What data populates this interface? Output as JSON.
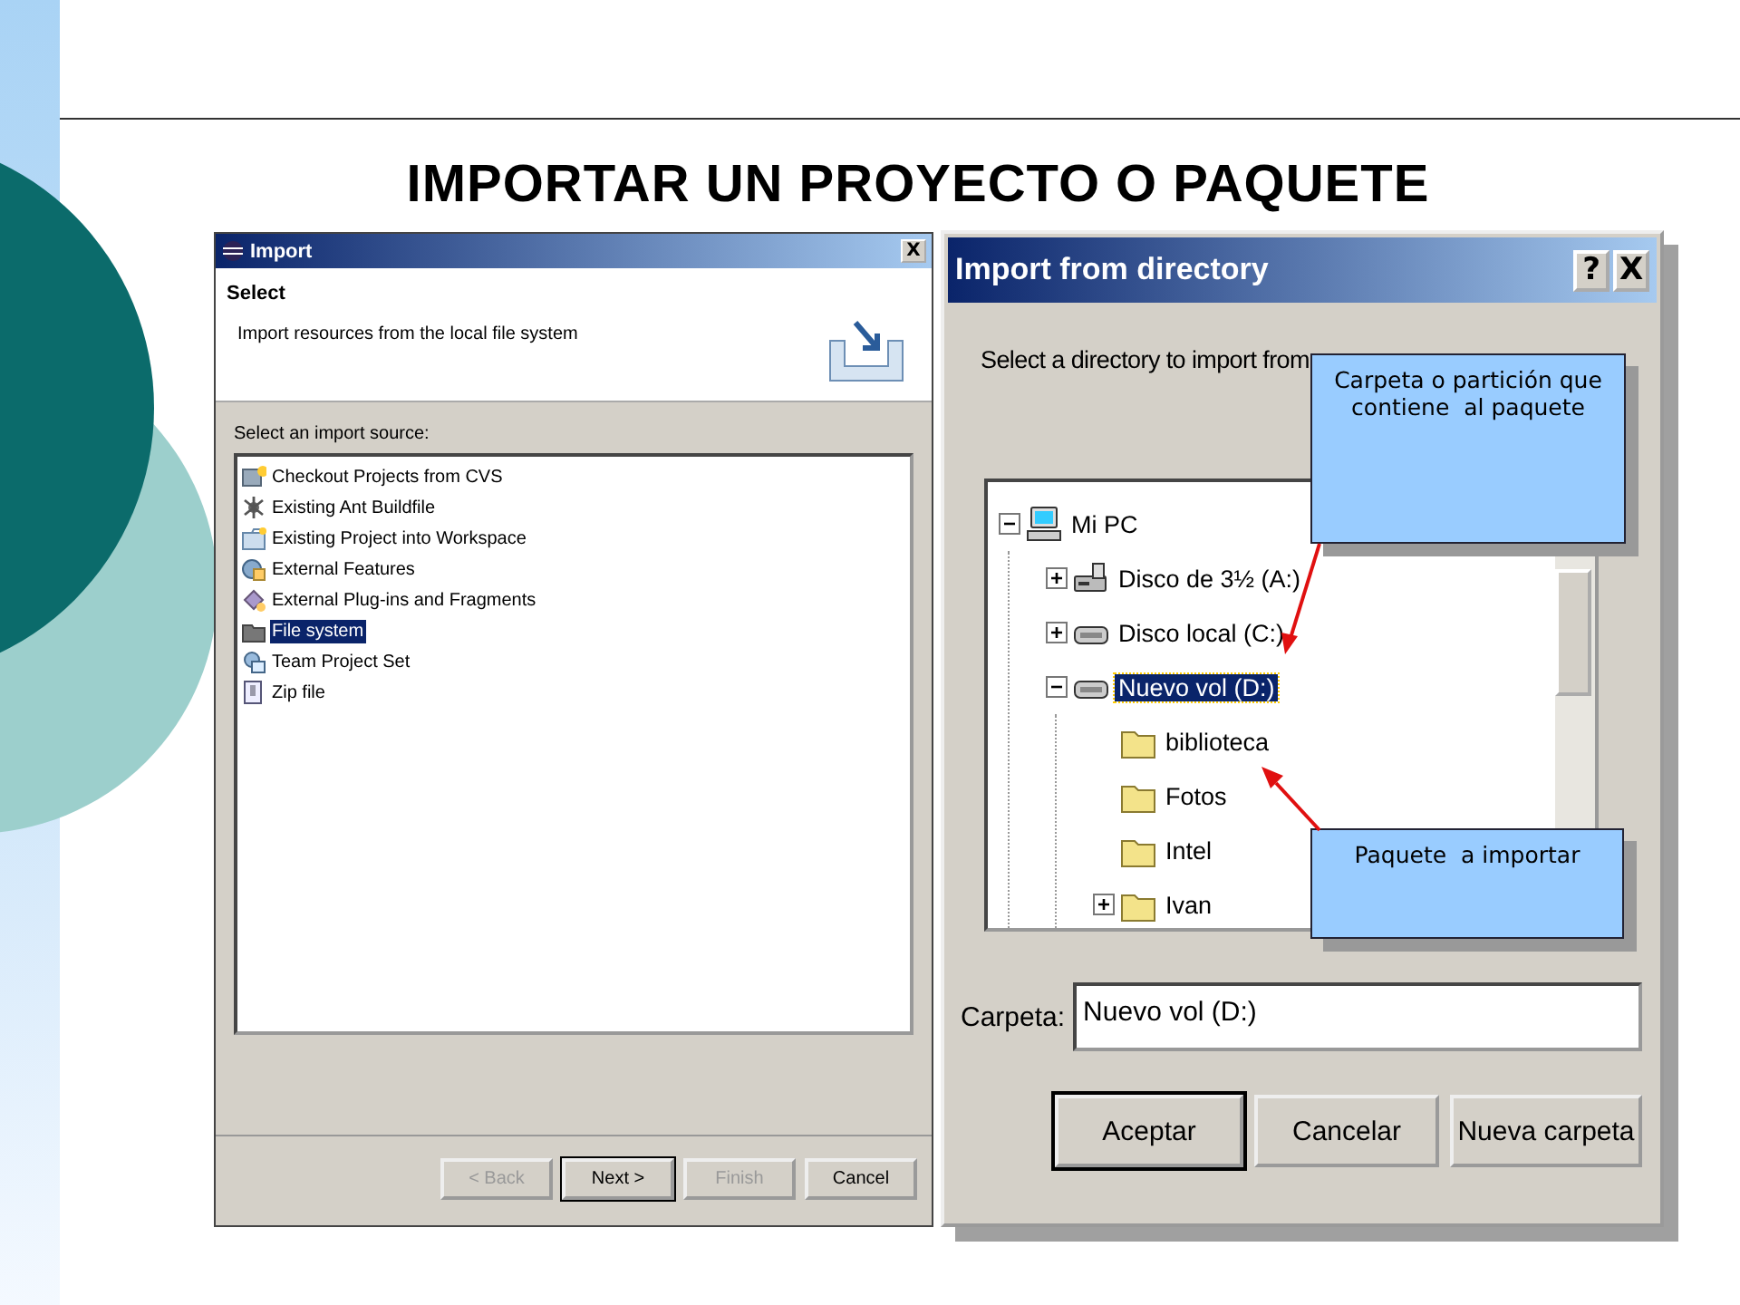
{
  "slide": {
    "title": "IMPORTAR UN PROYECTO O PAQUETE"
  },
  "import_dialog": {
    "title": "Import",
    "close": "X",
    "heading": "Select",
    "description": "Import resources from the local file system",
    "list_label": "Select an import source:",
    "sources": [
      {
        "label": "Checkout Projects from CVS",
        "kind": "cvs",
        "selected": false
      },
      {
        "label": "Existing Ant Buildfile",
        "kind": "ant",
        "selected": false
      },
      {
        "label": "Existing Project into Workspace",
        "kind": "project",
        "selected": false
      },
      {
        "label": "External Features",
        "kind": "features",
        "selected": false
      },
      {
        "label": "External Plug-ins and Fragments",
        "kind": "plugins",
        "selected": false
      },
      {
        "label": "File system",
        "kind": "folder",
        "selected": true
      },
      {
        "label": "Team Project Set",
        "kind": "team",
        "selected": false
      },
      {
        "label": "Zip file",
        "kind": "zip",
        "selected": false
      }
    ],
    "buttons": [
      {
        "label": "< Back",
        "disabled": true,
        "default": false
      },
      {
        "label": "Next >",
        "disabled": false,
        "default": true
      },
      {
        "label": "Finish",
        "disabled": true,
        "default": false
      },
      {
        "label": "Cancel",
        "disabled": false,
        "default": false
      }
    ]
  },
  "directory_dialog": {
    "title": "Import from directory",
    "help": "?",
    "close": "X",
    "prompt": "Select a directory to import from",
    "tree": [
      {
        "label": "Mi PC",
        "kind": "computer",
        "expanded": true,
        "selected": false,
        "children": [
          {
            "label": "Disco de 3½ (A:)",
            "kind": "floppy",
            "expanded": false,
            "selected": false
          },
          {
            "label": "Disco local (C:)",
            "kind": "drive",
            "expanded": false,
            "selected": false
          },
          {
            "label": "Nuevo vol (D:)",
            "kind": "drive",
            "expanded": true,
            "selected": true,
            "children": [
              {
                "label": "biblioteca",
                "kind": "folder",
                "selected": false
              },
              {
                "label": "Fotos",
                "kind": "folder",
                "selected": false
              },
              {
                "label": "Intel",
                "kind": "folder",
                "selected": false
              },
              {
                "label": "Ivan",
                "kind": "folder",
                "expanded": false,
                "selected": false
              }
            ]
          }
        ]
      }
    ],
    "folder_label": "Carpeta:",
    "folder_value": "Nuevo vol (D:)",
    "buttons": [
      {
        "label": "Aceptar",
        "default": true
      },
      {
        "label": "Cancelar",
        "default": false
      },
      {
        "label": "Nueva carpeta",
        "default": false
      }
    ]
  },
  "callouts": [
    {
      "text": "Carpeta o partición que contiene  al paquete"
    },
    {
      "text": "Paquete  a importar"
    }
  ]
}
